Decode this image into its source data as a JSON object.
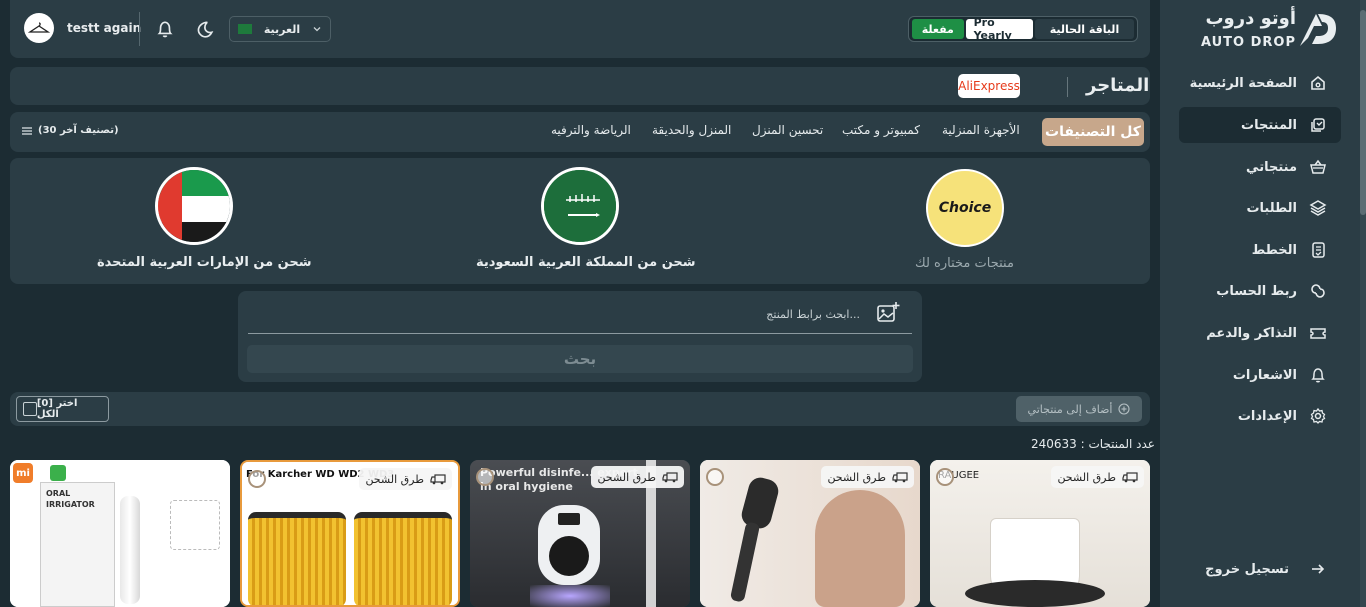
{
  "app": {
    "logo_ar": "أوتو دروب",
    "logo_en": "AUTO DROP"
  },
  "sidebar": {
    "items": [
      {
        "label": "الصفحة الرئيسية",
        "icon": "home-icon"
      },
      {
        "label": "المنتجات",
        "icon": "products-icon",
        "active": true
      },
      {
        "label": "منتجاتي",
        "icon": "basket-icon"
      },
      {
        "label": "الطلبات",
        "icon": "orders-icon"
      },
      {
        "label": "الخطط",
        "icon": "plans-icon"
      },
      {
        "label": "ربط الحساب",
        "icon": "link-icon"
      },
      {
        "label": "التذاكر والدعم",
        "icon": "ticket-icon"
      },
      {
        "label": "الاشعارات",
        "icon": "bell-icon"
      },
      {
        "label": "الإعدادات",
        "icon": "gear-icon"
      }
    ],
    "logout": "تسجيل خروج"
  },
  "topbar": {
    "user_name": "testt again",
    "language": "العربية",
    "plan_label": "الباقة الحالية",
    "plan_name": "Pro Yearly",
    "plan_status": "مفعلة"
  },
  "stores": {
    "title": "المتاجر",
    "store_logo": "AliExpress"
  },
  "categories": {
    "active": "كل التصنيفات",
    "items": [
      "الأجهزة المنزلية",
      "كمبيوتر و مكتب",
      "تحسين المنزل",
      "المنزل والحديقة",
      "الرياضة والترفيه"
    ],
    "more": "(30 تصنيف آخر)"
  },
  "shipping": {
    "choice_logo": "Choice",
    "choice_label": "منتجات مختاره لك",
    "saudi_label": "شحن من المملكة العربية السعودية",
    "uae_label": "شحن من الإمارات العربية المتحدة"
  },
  "search": {
    "placeholder": "ابحث برابط المنتج...",
    "button": "بحث"
  },
  "actions": {
    "add_to_my_products": "أضاف إلى منتجاتي",
    "select_all": "[0] اختر الكل"
  },
  "products": {
    "count_label": "عدد المنتجات : 240633",
    "shipping_tag": "طرق الشحن",
    "cards": [
      {
        "image_text": "RAUGEE"
      },
      {
        "image_text": ""
      },
      {
        "image_text": "Powerful disinfe... expert in oral hygiene"
      },
      {
        "image_text": "For Karcher WD WD2 WD3"
      },
      {
        "image_text": "ORAL IRRIGATOR"
      }
    ]
  },
  "colors": {
    "background": "#1c2c33",
    "panel": "#2b3d45",
    "accent": "#c7a78b",
    "active_green": "#1e8f45"
  }
}
